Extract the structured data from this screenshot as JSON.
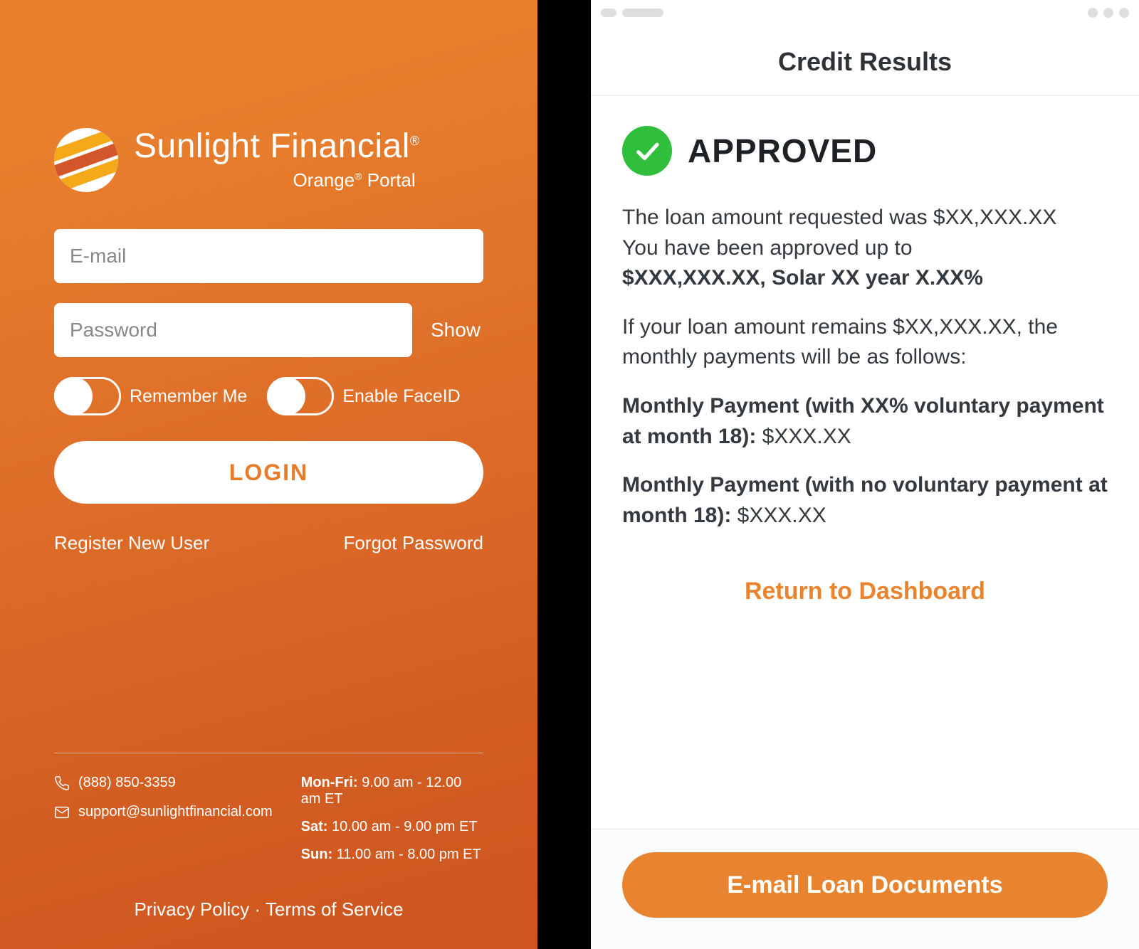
{
  "brand": {
    "name_main": "Sunlight Financial",
    "reg_mark": "®",
    "subtitle_prefix": "Orange",
    "subtitle_suffix": "Portal"
  },
  "login": {
    "email_placeholder": "E-mail",
    "password_placeholder": "Password",
    "show_label": "Show",
    "remember_label": "Remember Me",
    "faceid_label": "Enable FaceID",
    "login_button": "LOGIN",
    "register_link": "Register New User",
    "forgot_link": "Forgot Password"
  },
  "footer": {
    "phone": "(888) 850-3359",
    "email": "support@sunlightfinancial.com",
    "hours": [
      {
        "label": "Mon-Fri:",
        "value": " 9.00 am - 12.00 am ET"
      },
      {
        "label": "Sat:",
        "value": " 10.00 am - 9.00 pm ET"
      },
      {
        "label": "Sun:",
        "value": " 11.00 am - 8.00 pm ET"
      }
    ],
    "privacy": "Privacy Policy",
    "separator": " · ",
    "tos": "Terms of Service"
  },
  "results": {
    "header": "Credit Results",
    "approved": "APPROVED",
    "requested_line": "The loan amount requested was $XX,XXX.XX",
    "approved_line_prefix": "You have been approved up to ",
    "approved_line_bold": "$XXX,XXX.XX, Solar XX year X.XX%",
    "remains_line": "If your loan amount remains $XX,XXX.XX, the monthly payments will be as follows:",
    "monthly_with_label": "Monthly Payment (with XX% voluntary payment at month 18): ",
    "monthly_with_value": "$XXX.XX",
    "monthly_without_label": "Monthly Payment (with no voluntary payment at month 18): ",
    "monthly_without_value": "$XXX.XX",
    "return_link": "Return to Dashboard",
    "email_button": "E-mail Loan Documents"
  }
}
